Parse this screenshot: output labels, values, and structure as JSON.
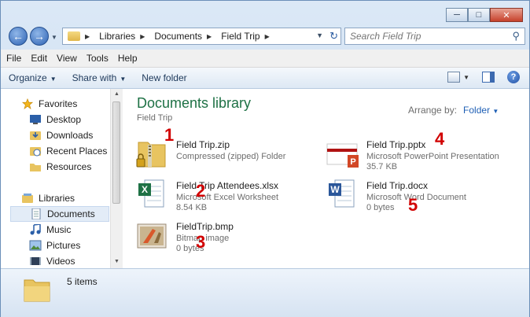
{
  "address": {
    "breadcrumbs": [
      "Libraries",
      "Documents",
      "Field Trip"
    ]
  },
  "search": {
    "placeholder": "Search Field Trip"
  },
  "menu": [
    "File",
    "Edit",
    "View",
    "Tools",
    "Help"
  ],
  "toolbar": {
    "organize": "Organize",
    "share_with": "Share with",
    "new_folder": "New folder"
  },
  "nav": {
    "favorites": "Favorites",
    "desktop": "Desktop",
    "downloads": "Downloads",
    "recent_places": "Recent Places",
    "resources": "Resources",
    "libraries": "Libraries",
    "documents": "Documents",
    "music": "Music",
    "pictures": "Pictures",
    "videos": "Videos"
  },
  "library": {
    "title": "Documents library",
    "subtitle": "Field Trip",
    "arrange_label": "Arrange by:",
    "arrange_value": "Folder"
  },
  "files": [
    {
      "name": "Field Trip.zip",
      "type": "Compressed (zipped) Folder",
      "size": "",
      "marker": "1",
      "icon": "zip-folder-icon"
    },
    {
      "name": "Field Trip Attendees.xlsx",
      "type": "Microsoft Excel Worksheet",
      "size": "8.54 KB",
      "marker": "2",
      "icon": "excel-file-icon"
    },
    {
      "name": "FieldTrip.bmp",
      "type": "Bitmap image",
      "size": "0 bytes",
      "marker": "3",
      "icon": "bitmap-image-icon"
    },
    {
      "name": "Field Trip.pptx",
      "type": "Microsoft PowerPoint Presentation",
      "size": "35.7 KB",
      "marker": "4",
      "icon": "powerpoint-file-icon"
    },
    {
      "name": "Field Trip.docx",
      "type": "Microsoft Word Document",
      "size": "0 bytes",
      "marker": "5",
      "icon": "word-file-icon"
    }
  ],
  "details": {
    "count": "5 items"
  }
}
